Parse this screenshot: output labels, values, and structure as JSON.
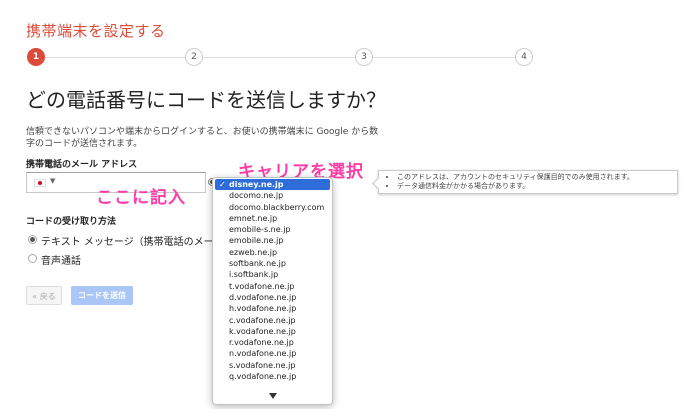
{
  "page": {
    "title": "携帯端末を設定する",
    "heading": "どの電話番号にコードを送信しますか？",
    "description": "信頼できないパソコンや端末からログインすると、お使いの携帯端末に Google から数字のコードが送信されます。"
  },
  "steps": [
    {
      "label": "1",
      "active": true
    },
    {
      "label": "2",
      "active": false
    },
    {
      "label": "3",
      "active": false
    },
    {
      "label": "4",
      "active": false
    }
  ],
  "phone_form": {
    "label": "携帯電話のメール アドレス",
    "input_value": "",
    "country": "jp-flag-icon"
  },
  "annotations": {
    "fill_here": "ここに記入",
    "select_carrier": "キャリアを選択"
  },
  "tooltip": {
    "items": [
      "このアドレスは、アカウントのセキュリティ保護目的でのみ使用されます。",
      "データ通信料金がかかる場合があります。"
    ]
  },
  "carrier_dropdown": {
    "selected": "disney.ne.jp",
    "options": [
      "disney.ne.jp",
      "docomo.ne.jp",
      "docomo.blackberry.com",
      "emnet.ne.jp",
      "emobile-s.ne.jp",
      "emobile.ne.jp",
      "ezweb.ne.jp",
      "softbank.ne.jp",
      "i.softbank.jp",
      "t.vodafone.ne.jp",
      "d.vodafone.ne.jp",
      "h.vodafone.ne.jp",
      "c.vodafone.ne.jp",
      "k.vodafone.ne.jp",
      "r.vodafone.ne.jp",
      "n.vodafone.ne.jp",
      "s.vodafone.ne.jp",
      "q.vodafone.ne.jp"
    ]
  },
  "delivery": {
    "label": "コードの受け取り方法",
    "options": [
      {
        "label": "テキスト メッセージ（携帯電話のメール）",
        "checked": true
      },
      {
        "label": "音声通話",
        "checked": false
      }
    ]
  },
  "buttons": {
    "back": "« 戻る",
    "send": "コードを送信"
  },
  "colors": {
    "brand_red": "#dd4b39",
    "annotation_pink": "#ff3da8",
    "selection_blue": "#2e6cd9",
    "send_button_disabled": "#a9c6f6"
  }
}
